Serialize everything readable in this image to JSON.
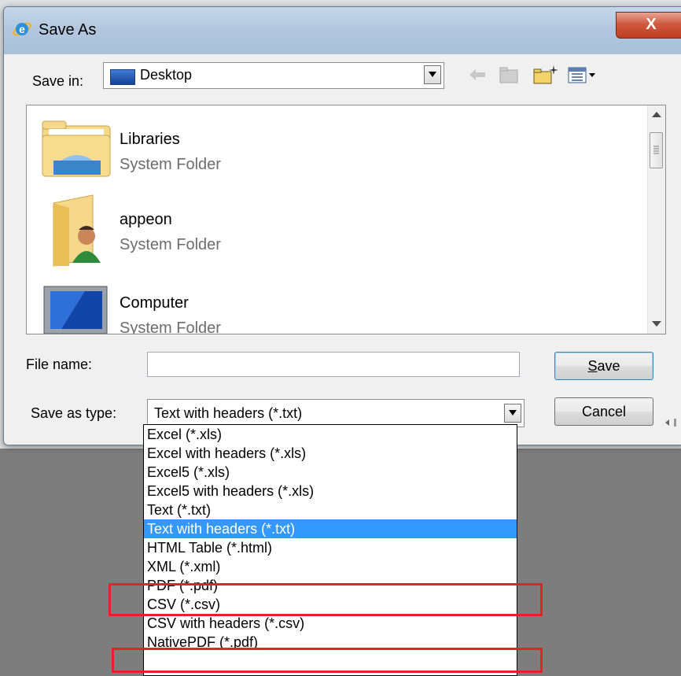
{
  "window": {
    "title": "Save As",
    "close_label": "X"
  },
  "save_in": {
    "label": "Save in:",
    "value": "Desktop"
  },
  "toolbar": {
    "icons": [
      "back-arrow-icon",
      "up-folder-icon",
      "new-folder-icon",
      "view-menu-icon"
    ]
  },
  "items": [
    {
      "name": "Libraries",
      "type": "System Folder",
      "icon": "libraries-folder-icon"
    },
    {
      "name": "appeon",
      "type": "System Folder",
      "icon": "user-folder-icon"
    },
    {
      "name": "Computer",
      "type": "System Folder",
      "icon": "computer-icon"
    }
  ],
  "file_name": {
    "label": "File name:",
    "value": ""
  },
  "save_as_type": {
    "label": "Save as type:",
    "value": "Text with headers (*.txt)"
  },
  "buttons": {
    "save_prefix": "",
    "save_hotkey": "S",
    "save_rest": "ave",
    "cancel": "Cancel"
  },
  "type_options": [
    "Excel (*.xls)",
    "Excel with headers (*.xls)",
    "Excel5 (*.xls)",
    "Excel5 with headers (*.xls)",
    "Text (*.txt)",
    "Text with headers (*.txt)",
    "HTML Table (*.html)",
    "XML (*.xml)",
    "PDF (*.pdf)",
    "CSV (*.csv)",
    "CSV with headers (*.csv)",
    "NativePDF (*.pdf)"
  ],
  "selected_option": "Text with headers (*.txt)",
  "highlighted_options": [
    "PDF (*.pdf)",
    "NativePDF (*.pdf)"
  ],
  "colors": {
    "selection": "#3399ff",
    "highlight_box": "#e8202a"
  }
}
